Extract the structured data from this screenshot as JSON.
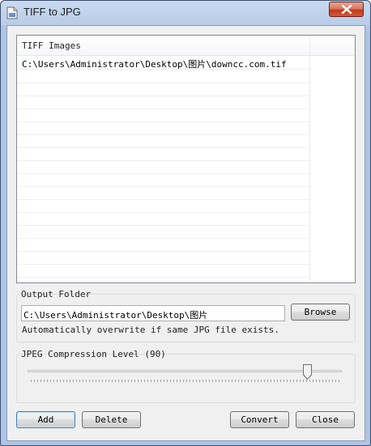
{
  "window": {
    "title": "TIFF to JPG",
    "close_icon": "close-x-icon",
    "app_icon": "tiff-to-jpg-app-icon"
  },
  "images_list": {
    "column_header": "TIFF Images",
    "items": [
      "C:\\Users\\Administrator\\Desktop\\图片\\downcc.com.tif"
    ]
  },
  "output_folder": {
    "group_label": "Output Folder",
    "path_value": "C:\\Users\\Administrator\\Desktop\\图片",
    "browse_label": "Browse",
    "note": "Automatically overwrite if same JPG file exists."
  },
  "compression": {
    "group_label": "JPEG Compression Level (90)",
    "level": 90,
    "min": 0,
    "max": 100
  },
  "buttons": {
    "add": "Add",
    "delete": "Delete",
    "convert": "Convert",
    "close": "Close"
  },
  "colors": {
    "title_bar": "#b9cde9",
    "close_button": "#c13a1e",
    "dialog_bg": "#f0f0f0",
    "default_button_border": "#3c7fb1"
  }
}
